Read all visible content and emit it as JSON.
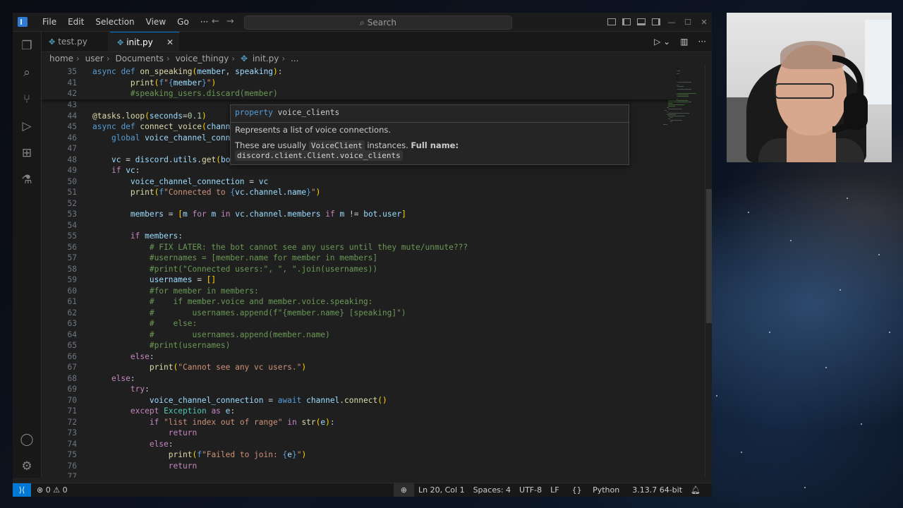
{
  "menu": [
    "File",
    "Edit",
    "Selection",
    "View",
    "Go",
    "···"
  ],
  "nav": {
    "back": "←",
    "forward": "→"
  },
  "search": {
    "label": "Search"
  },
  "window_controls": {
    "minimize": "—",
    "maximize": "☐",
    "close": "✕"
  },
  "tabs": [
    {
      "label": "test.py",
      "active": false
    },
    {
      "label": "init.py",
      "active": true
    }
  ],
  "tab_close": "✕",
  "breadcrumb": [
    "home",
    "user",
    "Documents",
    "voice_thingy",
    "init.py",
    "..."
  ],
  "code_lines": [
    {
      "n": "35",
      "text": "async def on_speaking(member, speaking):"
    },
    {
      "n": "41",
      "text": "        print(f\"{member}\")"
    },
    {
      "n": "42",
      "text": "        #speaking_users.discard(member)"
    },
    {
      "n": "43",
      "text": ""
    },
    {
      "n": "44",
      "text": "@tasks.loop(seconds=0.1)"
    },
    {
      "n": "45",
      "text": "async def connect_voice(channel"
    },
    {
      "n": "46",
      "text": "    global voice_channel_connec"
    },
    {
      "n": "47",
      "text": ""
    },
    {
      "n": "48",
      "text": "    vc = discord.utils.get(bot.voice_clients, guild=channel.guild)"
    },
    {
      "n": "49",
      "text": "    if vc:"
    },
    {
      "n": "50",
      "text": "        voice_channel_connection = vc"
    },
    {
      "n": "51",
      "text": "        print(f\"Connected to {vc.channel.name}\")"
    },
    {
      "n": "52",
      "text": ""
    },
    {
      "n": "53",
      "text": "        members = [m for m in vc.channel.members if m != bot.user]"
    },
    {
      "n": "54",
      "text": ""
    },
    {
      "n": "55",
      "text": "        if members:"
    },
    {
      "n": "56",
      "text": "            # FIX LATER: the bot cannot see any users until they mute/unmute???"
    },
    {
      "n": "57",
      "text": "            #usernames = [member.name for member in members]"
    },
    {
      "n": "58",
      "text": "            #print(\"Connected users:\", \", \".join(usernames))"
    },
    {
      "n": "59",
      "text": "            usernames = []"
    },
    {
      "n": "60",
      "text": "            #for member in members:"
    },
    {
      "n": "61",
      "text": "            #    if member.voice and member.voice.speaking:"
    },
    {
      "n": "62",
      "text": "            #        usernames.append(f\"{member.name} [speaking]\")"
    },
    {
      "n": "63",
      "text": "            #    else:"
    },
    {
      "n": "64",
      "text": "            #        usernames.append(member.name)"
    },
    {
      "n": "65",
      "text": "            #print(usernames)"
    },
    {
      "n": "66",
      "text": "        else:"
    },
    {
      "n": "67",
      "text": "            print(\"Cannot see any vc users.\")"
    },
    {
      "n": "68",
      "text": "    else:"
    },
    {
      "n": "69",
      "text": "        try:"
    },
    {
      "n": "70",
      "text": "            voice_channel_connection = await channel.connect()"
    },
    {
      "n": "71",
      "text": "        except Exception as e:"
    },
    {
      "n": "72",
      "text": "            if \"list index out of range\" in str(e):"
    },
    {
      "n": "73",
      "text": "                return"
    },
    {
      "n": "74",
      "text": "            else:"
    },
    {
      "n": "75",
      "text": "                print(f\"Failed to join: {e}\")"
    },
    {
      "n": "76",
      "text": "                return"
    },
    {
      "n": "77",
      "text": ""
    },
    {
      "n": "78",
      "text": "@bot.event"
    }
  ],
  "hover": {
    "keyword": "property",
    "name": "voice_clients",
    "description": "Represents a list of voice connections.",
    "usually_prefix": "These are usually",
    "usually_code": "VoiceClient",
    "usually_suffix": "instances.",
    "fullname_label": "Full name:",
    "fullname_value": "discord.client.Client.voice_clients"
  },
  "status": {
    "errors": "0",
    "warnings": "0",
    "position": "Ln 20, Col 1",
    "spaces": "Spaces: 4",
    "encoding": "UTF-8",
    "eol": "LF",
    "language": "Python",
    "interpreter": "3.13.7 64-bit"
  },
  "colors": {
    "accent": "#0078d4",
    "keyword": "#569cd6",
    "control": "#c586c0",
    "function": "#dcdcaa",
    "variable": "#9cdcfe",
    "string": "#ce9178",
    "comment": "#6a9955"
  }
}
